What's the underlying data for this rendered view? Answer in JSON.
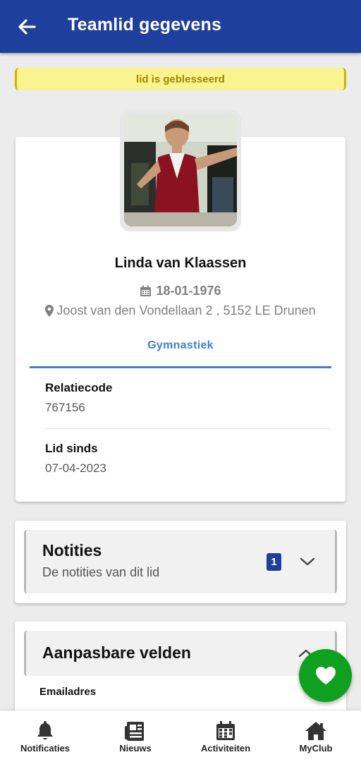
{
  "appbar": {
    "title": "Teamlid gegevens",
    "back_icon": "arrow-left-icon"
  },
  "banner": {
    "text": "lid is geblesseerd",
    "bg_color": "#fbf290",
    "text_color": "#9a8a00"
  },
  "profile": {
    "name": "Linda van Klaassen",
    "birth_date": "18-01-1976",
    "address": "Joost van den Vondellaan 2 , 5152 LE Drunen",
    "sport": "Gymnastiek",
    "fields": [
      {
        "label": "Relatiecode",
        "value": "767156"
      },
      {
        "label": "Lid sinds",
        "value": "07-04-2023"
      }
    ]
  },
  "notes": {
    "title": "Notities",
    "subtitle": "De notities van dit lid",
    "count": "1"
  },
  "custom_fields": {
    "title": "Aanpasbare velden",
    "first_label": "Emailadres"
  },
  "bottom_nav": [
    {
      "label": "Notificaties",
      "icon": "bell-icon"
    },
    {
      "label": "Nieuws",
      "icon": "newspaper-icon"
    },
    {
      "label": "Activiteiten",
      "icon": "calendar-icon"
    },
    {
      "label": "MyClub",
      "icon": "home-icon"
    }
  ],
  "colors": {
    "primary": "#1f3f9c",
    "accent": "#3f7fce",
    "fab": "#0fa020"
  }
}
